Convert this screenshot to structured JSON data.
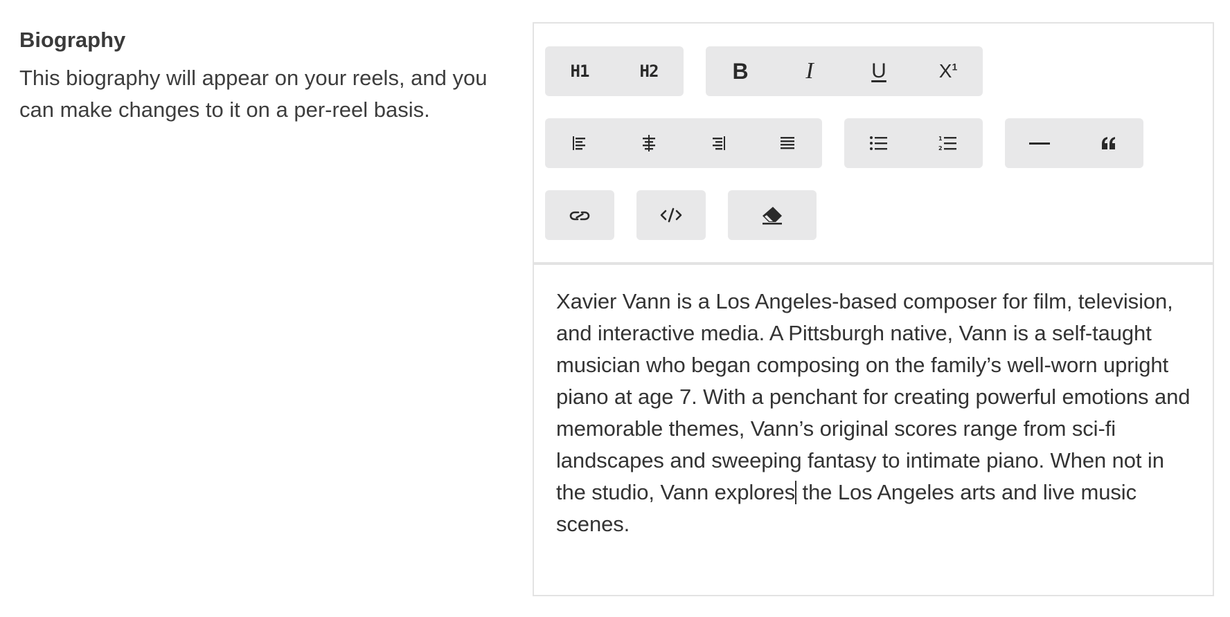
{
  "section": {
    "title": "Biography",
    "description": "This biography will appear on your reels, and you can make changes to it on a per-reel basis."
  },
  "toolbar": {
    "heading1": "H1",
    "heading2": "H2",
    "bold": "B",
    "italic": "I",
    "underline": "U",
    "superscript_base": "X",
    "superscript_mark": "1",
    "icons": [
      "align-left-icon",
      "align-center-icon",
      "align-right-icon",
      "align-justify-icon",
      "bullet-list-icon",
      "numbered-list-icon",
      "horizontal-rule-icon",
      "blockquote-icon",
      "link-icon",
      "code-icon",
      "eraser-icon"
    ]
  },
  "editor": {
    "text_before_cursor": "Xavier Vann is a Los Angeles-based composer for film, television, and interactive media. A Pittsburgh native, Vann is a self-taught musician who began composing on the family’s well-worn upright piano at age 7. With a penchant for creating powerful emotions and memorable themes, Vann’s original scores range from sci-fi landscapes and sweeping fantasy to intimate piano. When not in the studio, Vann explores",
    "text_after_cursor": " the Los Angeles arts and live music scenes."
  },
  "colors": {
    "button_group_bg": "#e8e8e9",
    "border": "#e3e3e3",
    "text": "#333333"
  }
}
